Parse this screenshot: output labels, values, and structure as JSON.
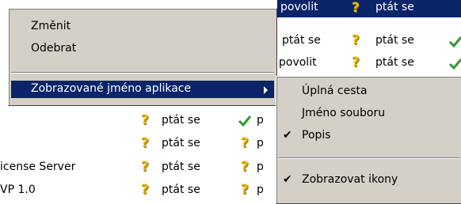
{
  "grid": {
    "rows": [
      {
        "name": "",
        "status": "ptát se",
        "col3": "povolit",
        "status2": "ptát se"
      },
      {
        "name": "",
        "status": "",
        "col3": "ptát se",
        "status2": "ptát se"
      },
      {
        "name": "",
        "status": "",
        "col3": "povolit",
        "status2": "ptát se"
      },
      {
        "name": "",
        "status": "ptát se",
        "col3": "p",
        "status2": ""
      },
      {
        "name": "",
        "status": "ptát se",
        "col3": "p",
        "status2": ""
      },
      {
        "name": "icense Server",
        "status": "ptát se",
        "col3": "p",
        "status2": ""
      },
      {
        "name": "VP 1.0",
        "status": "ptát se",
        "col3": "p",
        "status2": ""
      }
    ]
  },
  "context_menu": {
    "items": [
      {
        "label": "Změnit"
      },
      {
        "label": "Odebrat"
      },
      {
        "label": "Zobrazované jméno aplikace"
      }
    ]
  },
  "submenu": {
    "items": [
      {
        "label": "Úplná cesta",
        "checked": false
      },
      {
        "label": "Jméno souboru",
        "checked": false
      },
      {
        "label": "Popis",
        "checked": true
      },
      {
        "label": "Zobrazovat ikony",
        "checked": true
      }
    ],
    "check_mark": "✔"
  },
  "colors": {
    "highlight": "#0a246a",
    "menu_bg": "#d4d0c8",
    "question_icon": "#e8b800",
    "check_icon": "#2e9b2e"
  }
}
